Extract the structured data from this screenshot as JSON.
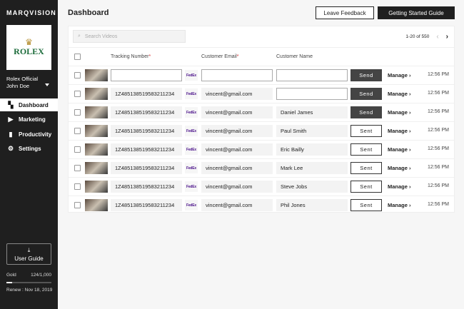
{
  "sidebar": {
    "brand": "MARQVISION",
    "logo_text": "ROLEX",
    "account_name": "Rolex Official",
    "user_name": "John Doe",
    "nav": [
      {
        "label": "Dashboard",
        "icon": "dashboard-icon",
        "glyph": "▚"
      },
      {
        "label": "Marketing",
        "icon": "play-icon",
        "glyph": "▶"
      },
      {
        "label": "Productivity",
        "icon": "bar-chart-icon",
        "glyph": "▮"
      },
      {
        "label": "Settings",
        "icon": "gear-icon",
        "glyph": "⚙"
      }
    ],
    "user_guide": "User Guide",
    "plan": "Gold",
    "usage": "124/1,000",
    "usage_fraction": 0.124,
    "renew": "Renew : Nov 18, 2019"
  },
  "header": {
    "title": "Dashboard",
    "feedback": "Leave Feedback",
    "guide": "Getting Started Guide"
  },
  "table": {
    "search_placeholder": "Search Videos",
    "pagination": "1-20 of 550",
    "columns": {
      "tracking": "Tracking Number",
      "email": "Customer Email",
      "name": "Customer Name",
      "required": "*"
    },
    "carrier": "FedEx",
    "rows": [
      {
        "tracking": "",
        "email": "",
        "name": "",
        "action": "Send",
        "manage": "Manage",
        "time": "12:56 PM"
      },
      {
        "tracking": "1Z485138519583211234",
        "email": "vincent@gmail.com",
        "name": "",
        "action": "Send",
        "manage": "Manage",
        "time": "12:56 PM"
      },
      {
        "tracking": "1Z485138519583211234",
        "email": "vincent@gmail.com",
        "name": "Daniel James",
        "action": "Send",
        "manage": "Manage",
        "time": "12:56 PM"
      },
      {
        "tracking": "1Z485138519583211234",
        "email": "vincent@gmail.com",
        "name": "Paul Smith",
        "action": "Sent",
        "manage": "Manage",
        "time": "12:56 PM"
      },
      {
        "tracking": "1Z485138519583211234",
        "email": "vincent@gmail.com",
        "name": "Eric Bailly",
        "action": "Sent",
        "manage": "Manage",
        "time": "12:56 PM"
      },
      {
        "tracking": "1Z485138519583211234",
        "email": "vincent@gmail.com",
        "name": "Mark Lee",
        "action": "Sent",
        "manage": "Manage",
        "time": "12:56 PM"
      },
      {
        "tracking": "1Z485138519583211234",
        "email": "vincent@gmail.com",
        "name": "Steve Jobs",
        "action": "Sent",
        "manage": "Manage",
        "time": "12:56 PM"
      },
      {
        "tracking": "1Z485138519583211234",
        "email": "vincent@gmail.com",
        "name": "Phil Jones",
        "action": "Sent",
        "manage": "Manage",
        "time": "12:56 PM"
      }
    ]
  }
}
